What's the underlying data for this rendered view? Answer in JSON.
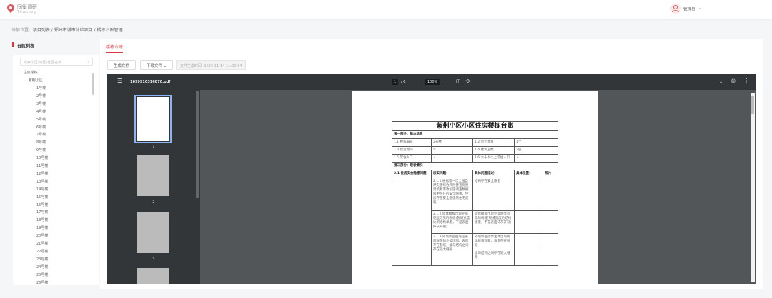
{
  "header": {
    "logo": "同衡调研",
    "logo_sub": "THtutong",
    "user": "管理员",
    "caret": "⌄"
  },
  "breadcrumb": {
    "label": "当前位置:",
    "items": [
      "项目列表",
      "郑州市城市体检项目",
      "楼栋台账管理"
    ]
  },
  "left": {
    "title": "台账列表",
    "search_placeholder": "搜索小区/地区/社区名称",
    "root": "住房楼栋",
    "community": "紫荆小区",
    "buildings": [
      "1号楼",
      "2号楼",
      "3号楼",
      "4号楼",
      "5号楼",
      "6号楼",
      "7号楼",
      "8号楼",
      "9号楼",
      "10号楼",
      "11号楼",
      "12号楼",
      "13号楼",
      "14号楼",
      "15号楼",
      "16号楼",
      "17号楼",
      "18号楼",
      "19号楼",
      "20号楼",
      "21号楼",
      "22号楼",
      "23号楼",
      "24号楼",
      "25号楼",
      "26号楼"
    ]
  },
  "tab": "楼栋台账",
  "actions": {
    "generate": "生成文件",
    "download": "下载文件 ⌄",
    "time": "文件生成时间: 2023-11-14 11:02:34"
  },
  "viewer": {
    "filename": "1699910316870.pdf",
    "page": "1",
    "pages": "/ 6",
    "zoom": "100%",
    "thumb_labels": [
      "1",
      "2",
      "3"
    ]
  },
  "doc": {
    "title": "紫荆小区小区住房楼栋台账",
    "part1": "第一部分：基本信息",
    "basic": [
      [
        "1.1 楼栋编号",
        "2号楼",
        "1.2 单元数量",
        "1个"
      ],
      [
        "1.3 建造时间",
        "年",
        "1.4 建筑层数",
        "2层"
      ],
      [
        "1.5 常住人口",
        "人",
        "1.6 六十岁以上常住人口",
        "人"
      ]
    ],
    "part2": "第二部分：现状情况",
    "headers": [
      "2.1 住房安全隐患问题",
      "核实问题：",
      "具体问题描述：",
      "具体位置：",
      "照片"
    ],
    "rows": [
      [
        "2.1.1 根据第一次全国自然灾害综合风险普查房屋建筑和市政设施调查数据库中存在的安全隐患，住房存在安全隐患的住宅建筑",
        "结构存在安全隐患"
      ],
      [
        "2.1.2 墙体模板出现外墙明显可见的裂缝(裂缝宽度达到结构承重，不是表面抹灰开裂)",
        "墙体模板出现外墙明显可见的裂缝(裂缝宽度达结构承重，不是表面抹灰开裂)"
      ],
      [
        "2.1.3 外墙饰面脱落是表面脱落的外墙饰面、表面存在裂缝，墙与结构之间存在较大缝隙",
        "外墙饰面墙体主体出现砖体脱落现象、表面存在裂缝"
      ],
      [
        "",
        "墙与结构之间存在较大缝隙"
      ]
    ]
  }
}
